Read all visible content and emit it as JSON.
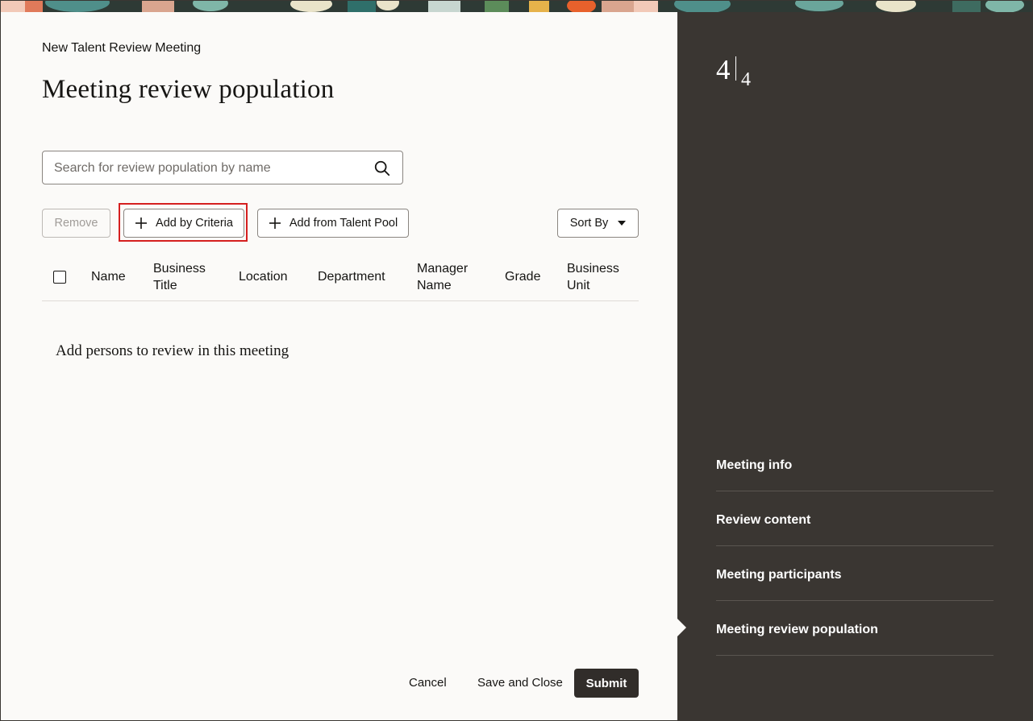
{
  "header": {
    "breadcrumb": "New Talent Review Meeting",
    "title": "Meeting review population"
  },
  "search": {
    "placeholder": "Search for review population by name",
    "value": "",
    "icon": "search-icon"
  },
  "toolbar": {
    "remove_label": "Remove",
    "add_by_criteria_label": "Add by Criteria",
    "add_from_pool_label": "Add from Talent Pool",
    "sort_label": "Sort By",
    "highlight_color": "#d51f1f"
  },
  "table": {
    "columns": [
      "Name",
      "Business\nTitle",
      "Location",
      "Department",
      "Manager\nName",
      "Grade",
      "Business\nUnit"
    ],
    "empty_message": "Add persons to review in this meeting"
  },
  "footer": {
    "cancel_label": "Cancel",
    "save_close_label": "Save and Close",
    "submit_label": "Submit"
  },
  "steps": {
    "current": "4",
    "total": "4",
    "items": [
      {
        "label": "Meeting info"
      },
      {
        "label": "Review content"
      },
      {
        "label": "Meeting participants"
      },
      {
        "label": "Meeting review population"
      }
    ],
    "active_index": 3
  },
  "colors": {
    "side_panel": "#3a3632",
    "primary_button": "#312d2a",
    "page_bg": "#fbfaf8"
  }
}
